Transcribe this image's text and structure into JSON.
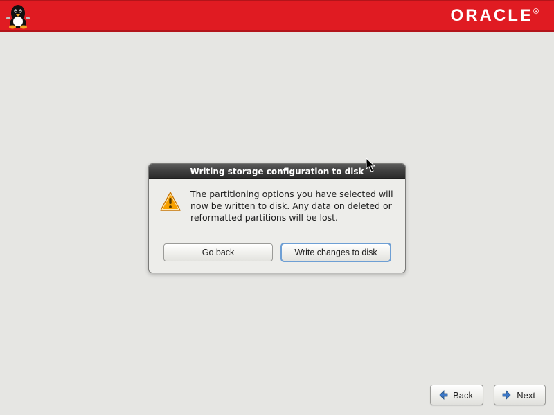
{
  "header": {
    "brand": "ORACLE",
    "logo_name": "tux-penguin-logo"
  },
  "dialog": {
    "title": "Writing storage configuration to disk",
    "message": "The partitioning options you have selected will now be written to disk.  Any data on deleted or reformatted partitions will be lost.",
    "go_back_label": "Go back",
    "write_label": "Write changes to disk"
  },
  "nav": {
    "back_label": "Back",
    "next_label": "Next"
  }
}
